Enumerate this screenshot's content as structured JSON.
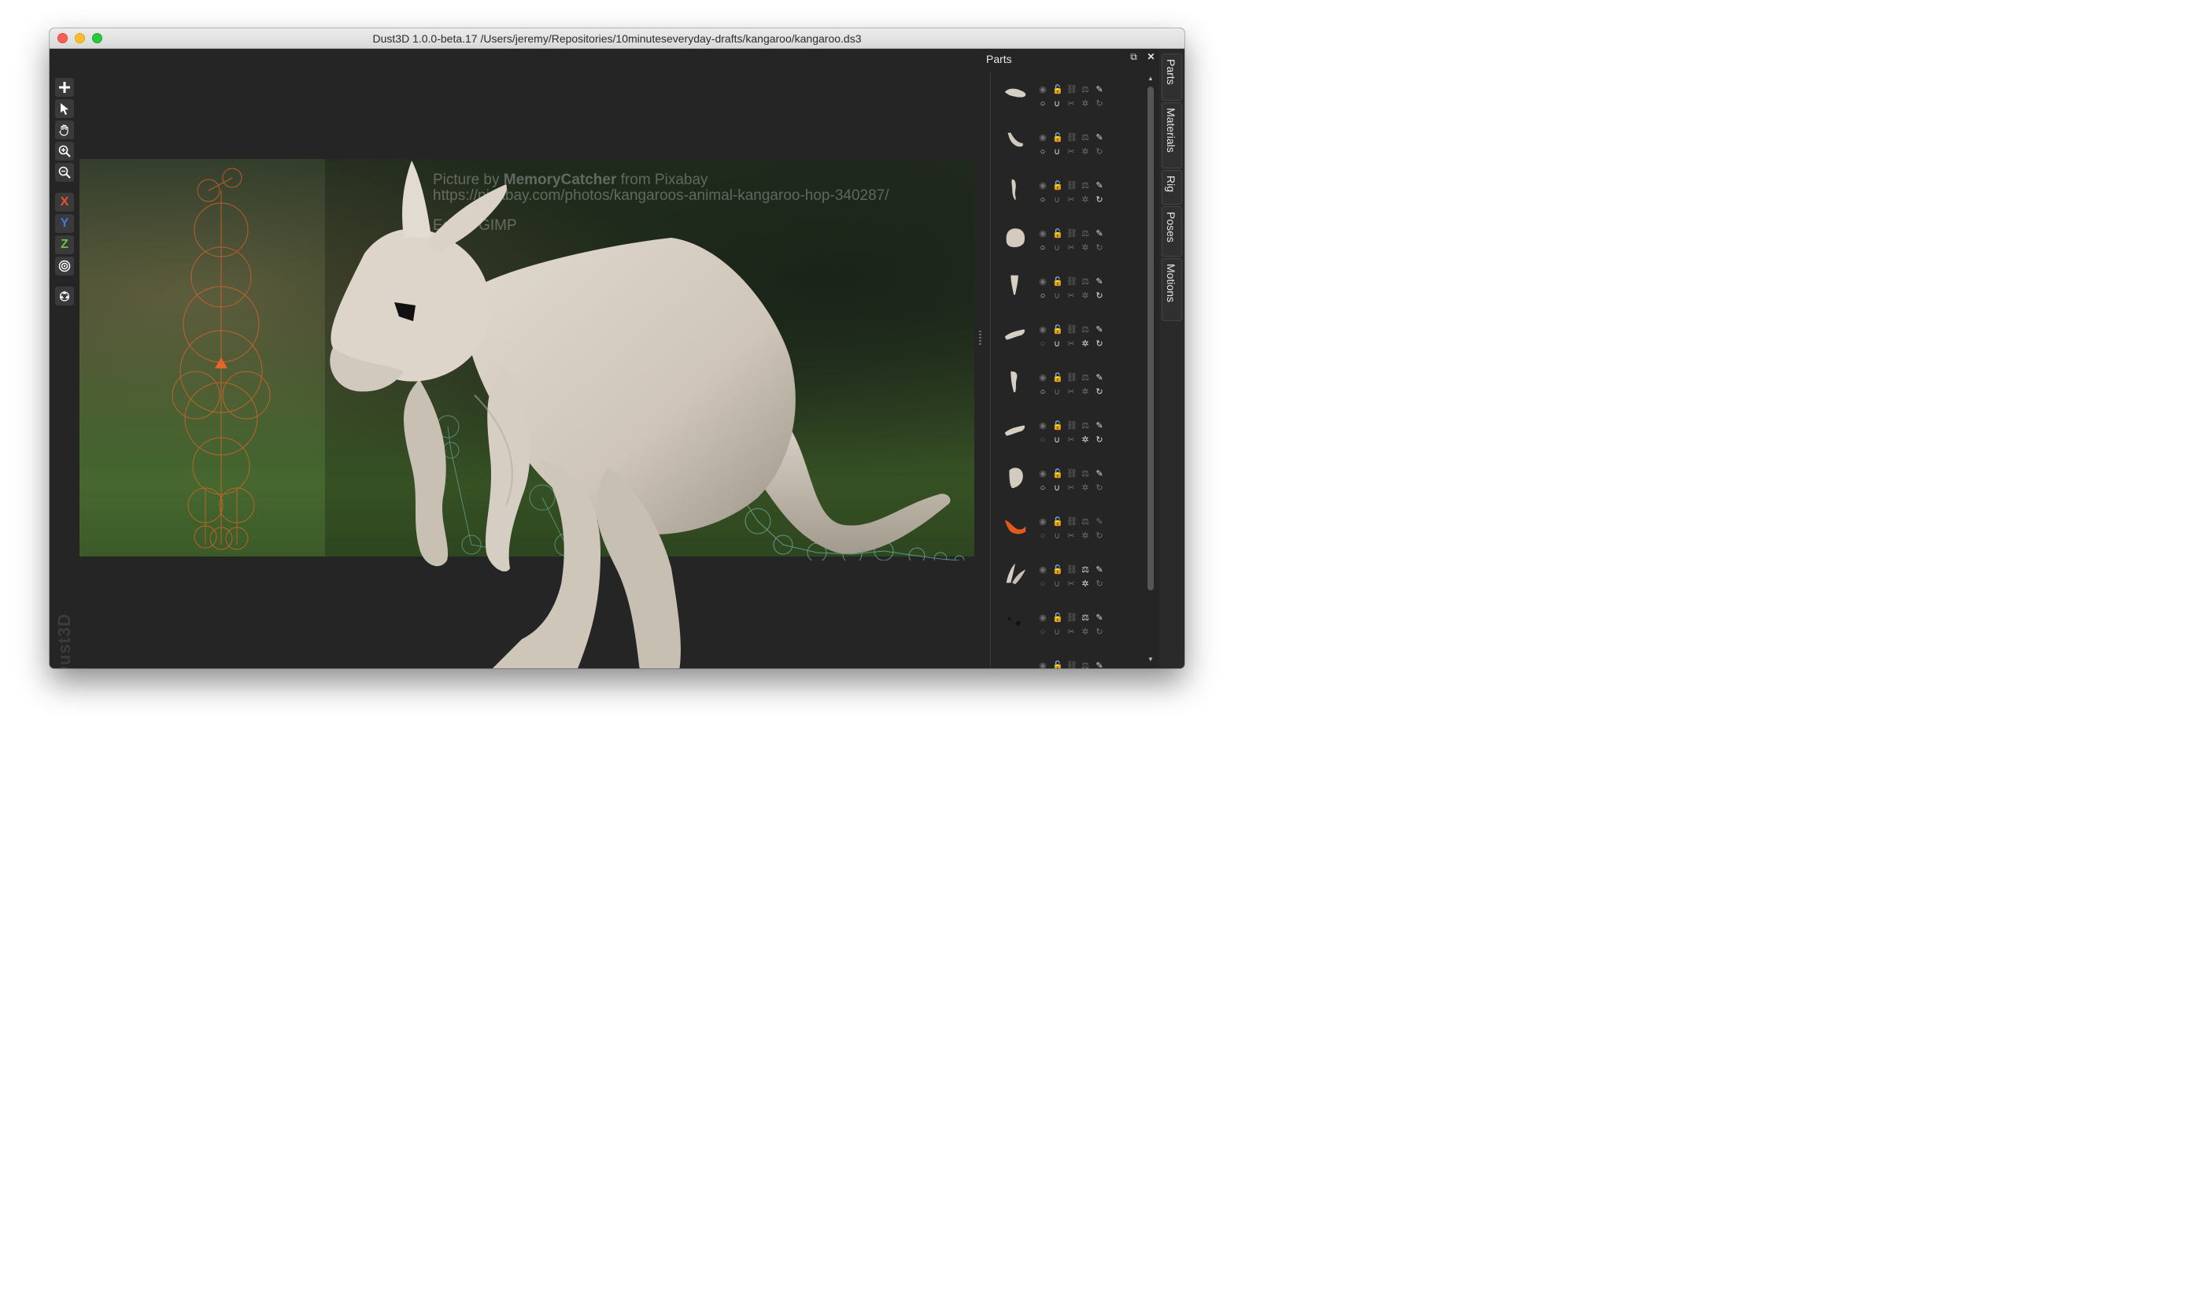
{
  "window": {
    "title": "Dust3D 1.0.0-beta.17 /Users/jeremy/Repositories/10minuteseveryday-drafts/kangaroo/kangaroo.ds3"
  },
  "toolbar": {
    "axes": {
      "x": "X",
      "y": "Y",
      "z": "Z"
    },
    "icons": [
      "add-icon",
      "select-icon",
      "pan-hand-icon",
      "zoom-in-icon",
      "zoom-out-icon",
      "x-axis",
      "y-axis",
      "z-axis",
      "radial-target-icon",
      "recycle-icon"
    ]
  },
  "canvas": {
    "brand": "Dust3D",
    "reference_image_text": {
      "prefix": "Picture by ",
      "author": "MemoryCatcher",
      "suffix": " from Pixabay",
      "url": "https://pixabay.com/photos/kangaroos-animal-kangaroo-hop-340287/",
      "edit_note": "Edit in GIMP"
    }
  },
  "parts_panel": {
    "title": "Parts",
    "rows": [
      {
        "shape": "head",
        "icons": [
          "eye",
          "lock",
          "link",
          "scale",
          "pencil",
          "circle",
          "magnet",
          "cut",
          "gear",
          "rotate"
        ]
      },
      {
        "shape": "neck",
        "icons": [
          "eye",
          "lock",
          "link",
          "scale",
          "pencil",
          "circle",
          "magnet",
          "cut",
          "gear",
          "rotate"
        ]
      },
      {
        "shape": "ear",
        "icons": [
          "eye",
          "lock",
          "link",
          "scale",
          "pencil",
          "circle",
          "magnet",
          "cut",
          "gear",
          "rotate"
        ]
      },
      {
        "shape": "body",
        "icons": [
          "eye",
          "lock",
          "link",
          "scale",
          "pencil",
          "circle",
          "magnet",
          "cut",
          "gear",
          "rotate"
        ]
      },
      {
        "shape": "leg",
        "icons": [
          "eye",
          "lock",
          "link",
          "scale",
          "pencil",
          "circle",
          "magnet",
          "cut",
          "gear",
          "rotate"
        ]
      },
      {
        "shape": "foot",
        "icons": [
          "eye",
          "lock",
          "link",
          "scale",
          "pencil",
          "circle",
          "magnet",
          "cut",
          "gear",
          "rotate"
        ]
      },
      {
        "shape": "arm",
        "icons": [
          "eye",
          "lock",
          "link",
          "scale",
          "pencil",
          "circle",
          "magnet",
          "cut",
          "gear",
          "rotate"
        ]
      },
      {
        "shape": "foot",
        "icons": [
          "eye",
          "lock",
          "link",
          "scale",
          "pencil",
          "circle",
          "magnet",
          "cut",
          "gear",
          "rotate"
        ]
      },
      {
        "shape": "thigh",
        "icons": [
          "eye",
          "lock",
          "link",
          "scale",
          "pencil",
          "circle",
          "magnet",
          "cut",
          "gear",
          "rotate"
        ]
      },
      {
        "shape": "tail-orange",
        "icons": [
          "eye",
          "lock",
          "link",
          "scale",
          "pencil",
          "circle",
          "magnet",
          "cut",
          "gear",
          "rotate"
        ]
      },
      {
        "shape": "ears-pair",
        "icons": [
          "eye",
          "lock",
          "link",
          "scale",
          "pencil",
          "circle",
          "magnet",
          "cut",
          "gear",
          "rotate"
        ]
      },
      {
        "shape": "eyes-dots",
        "icons": [
          "eye",
          "lock",
          "link",
          "scale",
          "pencil",
          "circle",
          "magnet",
          "cut",
          "gear",
          "rotate"
        ]
      },
      {
        "shape": "partial",
        "icons": [
          "eye",
          "lock",
          "link",
          "scale",
          "pencil"
        ]
      }
    ]
  },
  "side_tabs": [
    "Parts",
    "Materials",
    "Rig",
    "Poses",
    "Motions"
  ],
  "colors": {
    "background": "#252525",
    "axis_x": "#e8542a",
    "axis_y": "#3a7bd5",
    "axis_z": "#6cc04a",
    "model": "#d3cbbf",
    "selected_part": "#e35a1a"
  }
}
